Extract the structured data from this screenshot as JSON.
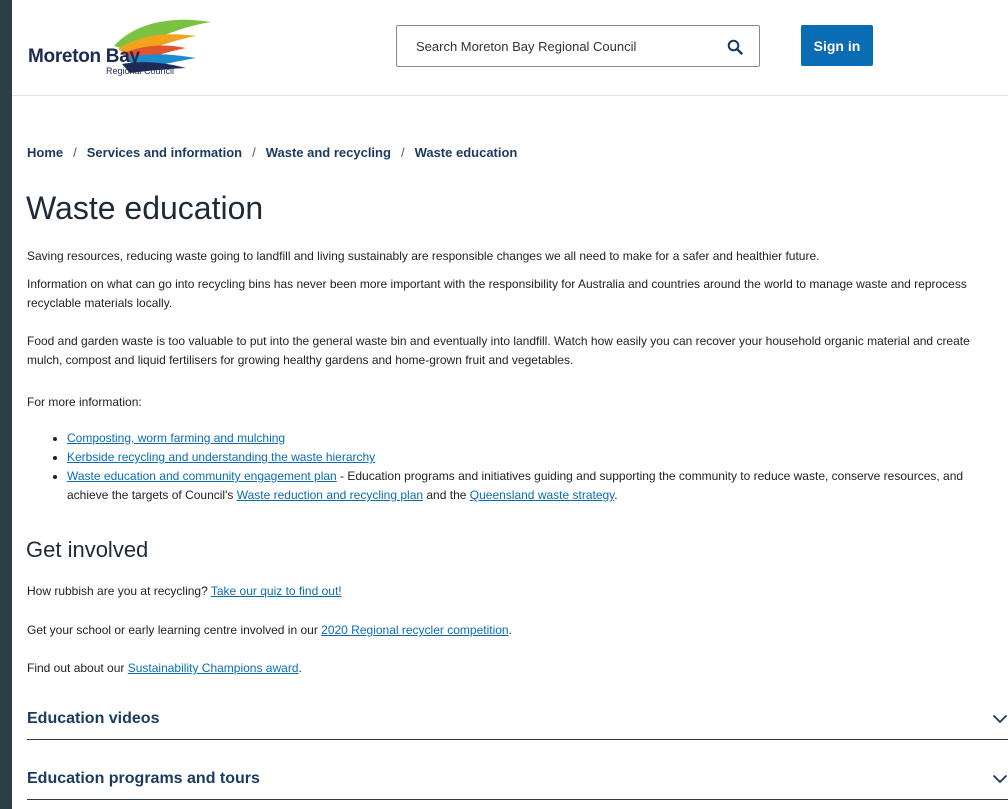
{
  "header": {
    "logo_word": "Moreton Bay",
    "logo_sub": "Regional Council",
    "search_placeholder": "Search Moreton Bay Regional Council",
    "signin_label": "Sign in"
  },
  "breadcrumb": [
    "Home",
    "Services and information",
    "Waste and recycling",
    "Waste education"
  ],
  "page_title": "Waste education",
  "intro": {
    "p1": "Saving resources, reducing waste going to landfill and living sustainably are responsible changes we all need to make for a safer and healthier future.",
    "p2": "Information on what can go into recycling bins has never been more important with the responsibility for Australia and countries around the world to manage waste and reprocess recyclable materials locally.",
    "p3": "Food and garden waste is too valuable to put into the general waste bin and eventually into landfill. Watch how easily you can recover your household organic material and create mulch, compost and liquid fertilisers for growing healthy gardens and home-grown fruit and vegetables.",
    "p4": "For more information:"
  },
  "links": {
    "item1": "Composting, worm farming and mulching",
    "item2": "Kerbside recycling and understanding the waste hierarchy",
    "item3_link": "Waste education and community engagement plan",
    "item3_text1": " - Education programs and initiatives guiding and supporting the community to reduce waste, conserve resources, and achieve the targets of Council's ",
    "item3_link2": "Waste reduction and recycling plan",
    "item3_text2": " and the ",
    "item3_link3": "Queensland waste strategy",
    "item3_end": "."
  },
  "get_involved": {
    "heading": "Get involved",
    "line1_text": "How rubbish are you at recycling? ",
    "line1_link": "Take our quiz to find out!",
    "line2_text": "Get your school or early learning centre involved in our ",
    "line2_link": "2020 Regional recycler competition",
    "line2_end": ".",
    "line3_text": "Find out about our ",
    "line3_link": "Sustainability Champions award",
    "line3_end": "."
  },
  "accordions": [
    {
      "title": "Education videos"
    },
    {
      "title": "Education programs and tours"
    }
  ],
  "colors": {
    "accent": "#0a6db4",
    "heading": "#1a3a5f",
    "frame": "#2e3e47"
  }
}
